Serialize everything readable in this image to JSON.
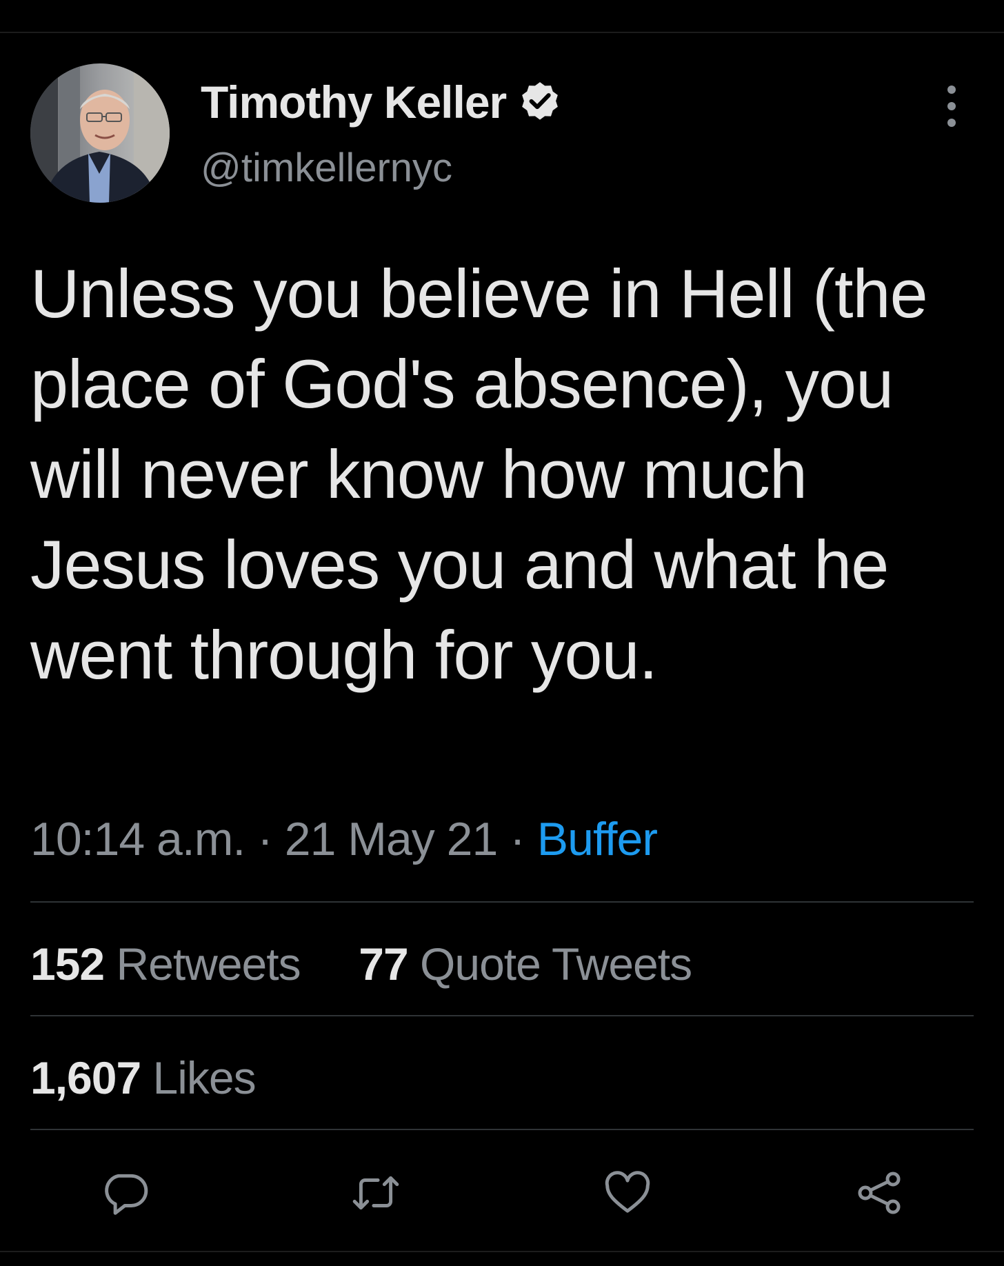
{
  "author": {
    "display_name": "Timothy Keller",
    "handle": "@timkellernyc",
    "verified": true
  },
  "tweet": {
    "text": "Unless you believe in Hell (the place of God's absence), you will never know how much Jesus loves you and what he went through for you.",
    "time": "10:14 a.m.",
    "separator": "·",
    "date": "21 May 21",
    "source": "Buffer"
  },
  "stats": {
    "retweets_count": "152",
    "retweets_label": "Retweets",
    "quotes_count": "77",
    "quotes_label": "Quote Tweets",
    "likes_count": "1,607",
    "likes_label": "Likes"
  },
  "actions": [
    {
      "icon": "reply-icon"
    },
    {
      "icon": "retweet-icon"
    },
    {
      "icon": "like-icon"
    },
    {
      "icon": "share-icon"
    }
  ],
  "colors": {
    "background": "#000000",
    "text_primary": "#e6e6e6",
    "text_secondary": "#8b9096",
    "link": "#1d9bf0",
    "divider": "#2f3336"
  }
}
